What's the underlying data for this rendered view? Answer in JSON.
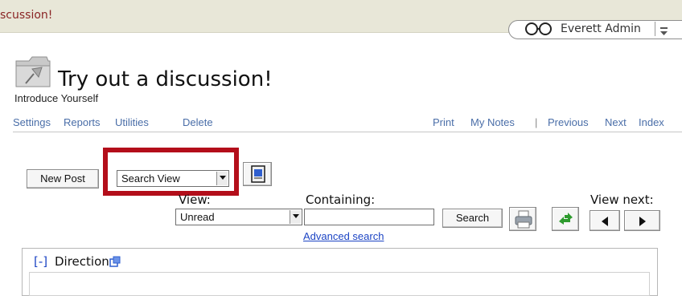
{
  "header": {
    "discussion_title_truncated": "scussion!",
    "user_name": "Everett Admin"
  },
  "page": {
    "title": "Try out a discussion!",
    "subtitle": "Introduce Yourself"
  },
  "nav": {
    "left_links": [
      "Settings",
      "Reports",
      "Utilities",
      "Delete"
    ],
    "print": "Print",
    "my_notes": "My Notes",
    "separator": "|",
    "previous": "Previous",
    "next": "Next",
    "index": "Index"
  },
  "toolbar": {
    "new_post_label": "New Post",
    "view_mode_selected": "Search View",
    "view_label": "View:",
    "view_selected": "Unread",
    "containing_label": "Containing:",
    "containing_value": "",
    "search_label": "Search",
    "advanced_search_label": "Advanced search",
    "view_next_label": "View next:"
  },
  "directions": {
    "toggle": "[-]",
    "title": "Directions"
  },
  "icons": {
    "user": "glasses-icon",
    "user_menu": "menu-icon",
    "page": "pinned-folder-icon",
    "document_view": "document-view-icon",
    "print": "printer-icon",
    "refresh": "refresh-arrows-icon",
    "previous": "left-triangle-icon",
    "next": "right-triangle-icon",
    "popout": "popout-icon"
  },
  "colors": {
    "banner_bg": "#e8e7d8",
    "title_red": "#8a2424",
    "link_blue": "#4a6ea8",
    "highlight_red": "#b30e1a"
  }
}
